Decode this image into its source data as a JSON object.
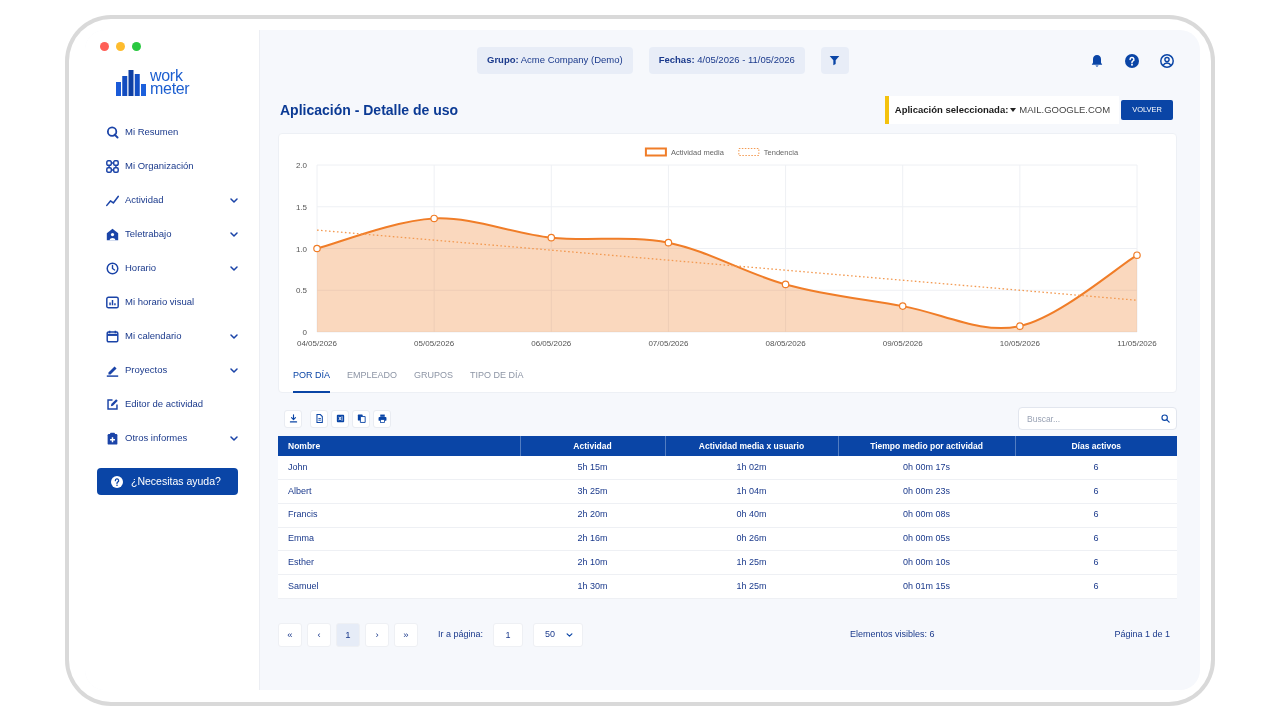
{
  "sidebar": {
    "logo": [
      "work",
      "meter"
    ],
    "items": [
      {
        "label": "Mi Resumen",
        "has_submenu": false
      },
      {
        "label": "Mi Organización",
        "has_submenu": false
      },
      {
        "label": "Actividad",
        "has_submenu": true
      },
      {
        "label": "Teletrabajo",
        "has_submenu": true
      },
      {
        "label": "Horario",
        "has_submenu": true
      },
      {
        "label": "Mi horario visual",
        "has_submenu": false
      },
      {
        "label": "Mi calendario",
        "has_submenu": true
      },
      {
        "label": "Proyectos",
        "has_submenu": true
      },
      {
        "label": "Editor de actividad",
        "has_submenu": false
      },
      {
        "label": "Otros informes",
        "has_submenu": true
      }
    ],
    "help_button": "¿Necesitas ayuda?"
  },
  "header": {
    "filters": [
      {
        "label": "Grupo:",
        "value": "Acme Company (Demo)"
      },
      {
        "label": "Fechas:",
        "value": "4/05/2026 - 11/05/2026"
      }
    ]
  },
  "title": "Aplicación - Detalle de uso",
  "selection": {
    "label": "Aplicación seleccionada:",
    "value": "MAIL.GOOGLE.COM",
    "button": "VOLVER"
  },
  "chart": {
    "chart_data": {
      "type": "area",
      "categories": [
        "04/05/2026",
        "05/05/2026",
        "06/05/2026",
        "07/05/2026",
        "08/05/2026",
        "09/05/2026",
        "10/05/2026",
        "11/05/2026"
      ],
      "series": [
        {
          "name": "Actividad media",
          "type": "area",
          "color": "#f07d28",
          "values": [
            1.0,
            1.36,
            1.13,
            1.07,
            0.57,
            0.31,
            0.07,
            0.92
          ]
        },
        {
          "name": "Tendencia",
          "type": "line",
          "line_style": "dotted",
          "color": "#f39a52",
          "values": [
            1.22,
            1.1,
            0.98,
            0.86,
            0.74,
            0.62,
            0.5,
            0.38
          ]
        }
      ],
      "ylim": [
        0,
        2
      ],
      "yticks": [
        0,
        0.5,
        {
          "value": 1,
          "label": "1.0"
        },
        1.5,
        {
          "value": 2,
          "label": "2.0"
        }
      ],
      "grid": true,
      "legend": "top"
    },
    "tabs": [
      {
        "label": "POR DÍA",
        "selected": true
      },
      {
        "label": "EMPLEADO",
        "selected": false
      },
      {
        "label": "GRUPOS",
        "selected": false
      },
      {
        "label": "TIPO DE DÍA",
        "selected": false
      }
    ]
  },
  "table": {
    "search": {
      "placeholder": "Buscar..."
    },
    "columns": [
      "Nombre",
      "Actividad",
      "Actividad media x usuario",
      "Tiempo medio por actividad",
      "Días activos"
    ],
    "rows": [
      [
        "John",
        "5h 15m",
        "1h 02m",
        "0h 00m 17s",
        "6"
      ],
      [
        "Albert",
        "3h 25m",
        "1h 04m",
        "0h 00m 23s",
        "6"
      ],
      [
        "Francis",
        "2h 20m",
        "0h 40m",
        "0h 00m 08s",
        "6"
      ],
      [
        "Emma",
        "2h 16m",
        "0h 26m",
        "0h 00m 05s",
        "6"
      ],
      [
        "Esther",
        "2h 10m",
        "1h 25m",
        "0h 00m 10s",
        "6"
      ],
      [
        "Samuel",
        "1h 30m",
        "1h 25m",
        "0h 01m 15s",
        "6"
      ]
    ]
  },
  "pagination": {
    "first": "«",
    "previous": "‹",
    "pages": [
      {
        "label": "1",
        "selected": true
      }
    ],
    "next": "›",
    "last": "»",
    "goto_label": "Ir a página:",
    "goto_value": "1",
    "page_size": "50",
    "visible_items": "Elementos visibles: 6",
    "page_info": "Página 1 de 1"
  }
}
